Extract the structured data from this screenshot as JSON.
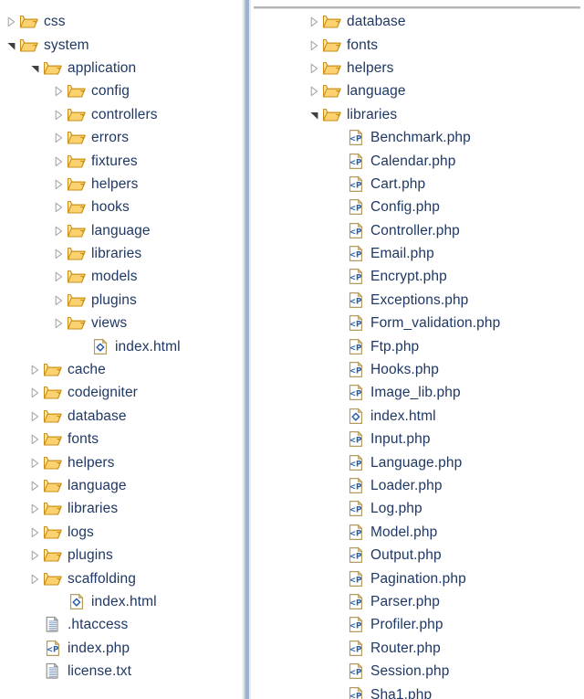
{
  "app": {
    "kind": "file-tree-explorer",
    "text_color": "#1f3864",
    "folder_color": "#f0b323",
    "divider_color": "#9db3cc",
    "rule_color": "#b6b6b6"
  },
  "left_pane": {
    "name": "left-tree-pane",
    "nodes": [
      {
        "label": "css",
        "type": "folder",
        "state": "collapsed",
        "level": 0
      },
      {
        "label": "system",
        "type": "folder",
        "state": "expanded",
        "level": 0
      },
      {
        "label": "application",
        "type": "folder",
        "state": "expanded",
        "level": 1
      },
      {
        "label": "config",
        "type": "folder",
        "state": "collapsed",
        "level": 2
      },
      {
        "label": "controllers",
        "type": "folder",
        "state": "collapsed",
        "level": 2
      },
      {
        "label": "errors",
        "type": "folder",
        "state": "collapsed",
        "level": 2
      },
      {
        "label": "fixtures",
        "type": "folder",
        "state": "collapsed",
        "level": 2
      },
      {
        "label": "helpers",
        "type": "folder",
        "state": "collapsed",
        "level": 2
      },
      {
        "label": "hooks",
        "type": "folder",
        "state": "collapsed",
        "level": 2
      },
      {
        "label": "language",
        "type": "folder",
        "state": "collapsed",
        "level": 2
      },
      {
        "label": "libraries",
        "type": "folder",
        "state": "collapsed",
        "level": 2
      },
      {
        "label": "models",
        "type": "folder",
        "state": "collapsed",
        "level": 2
      },
      {
        "label": "plugins",
        "type": "folder",
        "state": "collapsed",
        "level": 2
      },
      {
        "label": "views",
        "type": "folder",
        "state": "collapsed",
        "level": 2
      },
      {
        "label": "index.html",
        "type": "html",
        "state": "leaf",
        "level": 3
      },
      {
        "label": "cache",
        "type": "folder",
        "state": "collapsed",
        "level": 1
      },
      {
        "label": "codeigniter",
        "type": "folder",
        "state": "collapsed",
        "level": 1
      },
      {
        "label": "database",
        "type": "folder",
        "state": "collapsed",
        "level": 1
      },
      {
        "label": "fonts",
        "type": "folder",
        "state": "collapsed",
        "level": 1
      },
      {
        "label": "helpers",
        "type": "folder",
        "state": "collapsed",
        "level": 1
      },
      {
        "label": "language",
        "type": "folder",
        "state": "collapsed",
        "level": 1
      },
      {
        "label": "libraries",
        "type": "folder",
        "state": "collapsed",
        "level": 1
      },
      {
        "label": "logs",
        "type": "folder",
        "state": "collapsed",
        "level": 1
      },
      {
        "label": "plugins",
        "type": "folder",
        "state": "collapsed",
        "level": 1
      },
      {
        "label": "scaffolding",
        "type": "folder",
        "state": "collapsed",
        "level": 1
      },
      {
        "label": "index.html",
        "type": "html",
        "state": "leaf",
        "level": 2
      },
      {
        "label": ".htaccess",
        "type": "text",
        "state": "leaf",
        "level": 1
      },
      {
        "label": "index.php",
        "type": "php",
        "state": "leaf",
        "level": 1
      },
      {
        "label": "license.txt",
        "type": "text",
        "state": "leaf",
        "level": 1
      }
    ]
  },
  "right_pane": {
    "name": "right-tree-pane",
    "nodes": [
      {
        "label": "database",
        "type": "folder",
        "state": "collapsed",
        "level": 0
      },
      {
        "label": "fonts",
        "type": "folder",
        "state": "collapsed",
        "level": 0
      },
      {
        "label": "helpers",
        "type": "folder",
        "state": "collapsed",
        "level": 0
      },
      {
        "label": "language",
        "type": "folder",
        "state": "collapsed",
        "level": 0
      },
      {
        "label": "libraries",
        "type": "folder",
        "state": "expanded",
        "level": 0
      },
      {
        "label": "Benchmark.php",
        "type": "php",
        "state": "leaf",
        "level": 1
      },
      {
        "label": "Calendar.php",
        "type": "php",
        "state": "leaf",
        "level": 1
      },
      {
        "label": "Cart.php",
        "type": "php",
        "state": "leaf",
        "level": 1
      },
      {
        "label": "Config.php",
        "type": "php",
        "state": "leaf",
        "level": 1
      },
      {
        "label": "Controller.php",
        "type": "php",
        "state": "leaf",
        "level": 1
      },
      {
        "label": "Email.php",
        "type": "php",
        "state": "leaf",
        "level": 1
      },
      {
        "label": "Encrypt.php",
        "type": "php",
        "state": "leaf",
        "level": 1
      },
      {
        "label": "Exceptions.php",
        "type": "php",
        "state": "leaf",
        "level": 1
      },
      {
        "label": "Form_validation.php",
        "type": "php",
        "state": "leaf",
        "level": 1
      },
      {
        "label": "Ftp.php",
        "type": "php",
        "state": "leaf",
        "level": 1
      },
      {
        "label": "Hooks.php",
        "type": "php",
        "state": "leaf",
        "level": 1
      },
      {
        "label": "Image_lib.php",
        "type": "php",
        "state": "leaf",
        "level": 1
      },
      {
        "label": "index.html",
        "type": "html",
        "state": "leaf",
        "level": 1
      },
      {
        "label": "Input.php",
        "type": "php",
        "state": "leaf",
        "level": 1
      },
      {
        "label": "Language.php",
        "type": "php",
        "state": "leaf",
        "level": 1
      },
      {
        "label": "Loader.php",
        "type": "php",
        "state": "leaf",
        "level": 1
      },
      {
        "label": "Log.php",
        "type": "php",
        "state": "leaf",
        "level": 1
      },
      {
        "label": "Model.php",
        "type": "php",
        "state": "leaf",
        "level": 1
      },
      {
        "label": "Output.php",
        "type": "php",
        "state": "leaf",
        "level": 1
      },
      {
        "label": "Pagination.php",
        "type": "php",
        "state": "leaf",
        "level": 1
      },
      {
        "label": "Parser.php",
        "type": "php",
        "state": "leaf",
        "level": 1
      },
      {
        "label": "Profiler.php",
        "type": "php",
        "state": "leaf",
        "level": 1
      },
      {
        "label": "Router.php",
        "type": "php",
        "state": "leaf",
        "level": 1
      },
      {
        "label": "Session.php",
        "type": "php",
        "state": "leaf",
        "level": 1
      },
      {
        "label": "Sha1.php",
        "type": "php",
        "state": "leaf",
        "level": 1
      }
    ]
  }
}
